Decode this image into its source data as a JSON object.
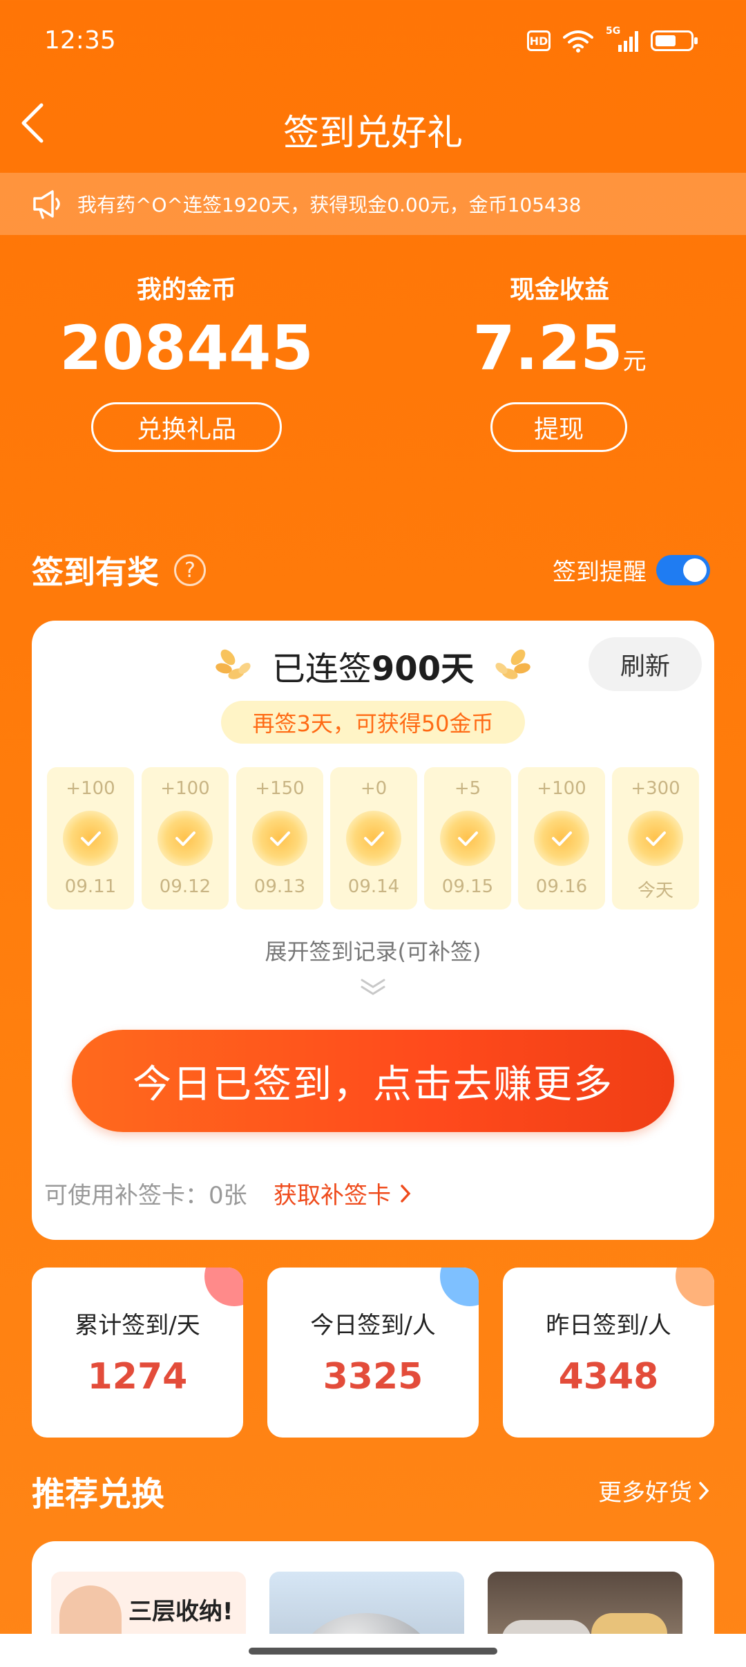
{
  "status_bar": {
    "time": "12:35",
    "hd": "HD",
    "network": "5G",
    "battery_level": 0.6
  },
  "header": {
    "title": "签到兑好礼"
  },
  "announcement": {
    "text": "我有药^O^连签1920天，获得现金0.00元，金币105438"
  },
  "assets": {
    "coins_label": "我的金币",
    "coins_value": "208445",
    "coins_button": "兑换礼品",
    "cash_label": "现金收益",
    "cash_value": "7.25",
    "cash_unit": "元",
    "cash_button": "提现"
  },
  "checkin": {
    "section_title": "签到有奖",
    "help": "?",
    "remind_label": "签到提醒",
    "remind_on": true,
    "streak_prefix": "已连签",
    "streak_days": "900天",
    "refresh": "刷新",
    "bonus_hint": "再签3天，可获得50金币",
    "days": [
      {
        "amount": "+100",
        "date": "09.11"
      },
      {
        "amount": "+100",
        "date": "09.12"
      },
      {
        "amount": "+150",
        "date": "09.13"
      },
      {
        "amount": "+0",
        "date": "09.14"
      },
      {
        "amount": "+5",
        "date": "09.15"
      },
      {
        "amount": "+100",
        "date": "09.16"
      },
      {
        "amount": "+300",
        "date": "今天"
      }
    ],
    "expand": "展开签到记录(可补签)",
    "cta": "今日已签到，点击去赚更多",
    "makeup_label": "可使用补签卡：0张",
    "makeup_link": "获取补签卡"
  },
  "stats": [
    {
      "label": "累计签到/天",
      "value": "1274",
      "color": "#ff8a8a"
    },
    {
      "label": "今日签到/人",
      "value": "3325",
      "color": "#7ec0ff"
    },
    {
      "label": "昨日签到/人",
      "value": "4348",
      "color": "#ffb27a"
    }
  ],
  "recommend": {
    "title": "推荐兑换",
    "more": "更多好货",
    "item1_text": "三层收纳!"
  },
  "colors": {
    "bg": "#ff7506",
    "accent": "#ef4b1c",
    "toggle": "#1f7cf2",
    "stat_value": "#e34c3a"
  }
}
